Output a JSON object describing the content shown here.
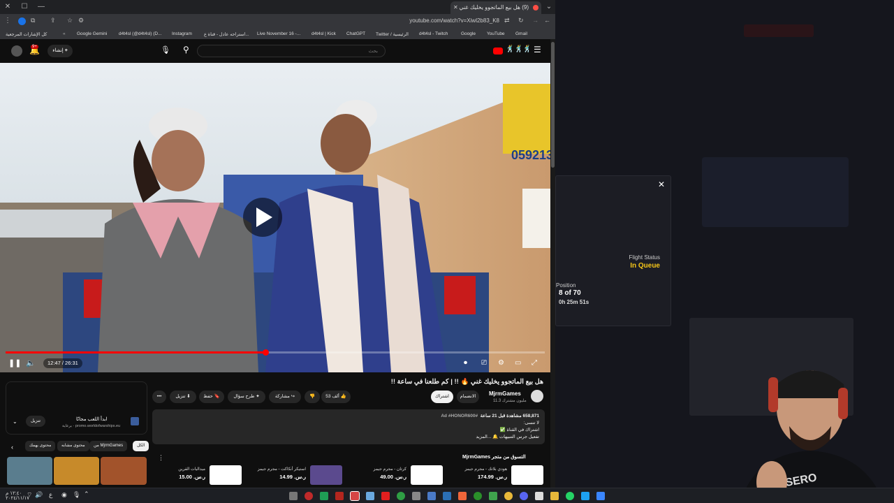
{
  "browser": {
    "tab_title": "(9) هل بيع الماتجوو يخليك غني",
    "url": "youtube.com/watch?v=Xiwl2b83_K8",
    "bookmarks": [
      "كل الإشارات المرجعية",
      "Google Gemini",
      "d4t4sl (@d4t4sl) (D...",
      "Instagram",
      "استراحه عادل - قناة ع...",
      "Live November 16 -...",
      "d4t4sl | Kick",
      "ChatGPT",
      "Twitter / الرئيسية",
      "d4t4sl - Twitch",
      "Google",
      "YouTube",
      "Gmail"
    ]
  },
  "yt_header": {
    "create_label": "إنشاء",
    "notification_count": "9+",
    "search_placeholder": "بحث"
  },
  "player": {
    "time": "12:47 / 26:31",
    "progress": 0.482,
    "billboard_number": "059213"
  },
  "video_info": {
    "title": "هل بيع الماتجوو يخليك غني 🔥 !! | كم طلعنا في ساعة !!",
    "channel_name": "MjrmGames",
    "subscribers": "11.3 مليون مشترك",
    "join_label": "الانضمام",
    "subscribe_label": "اشتراك",
    "like_count": "53 ألف",
    "share_label": "مشاركة",
    "ask_label": "طرح سؤال",
    "save_label": "حفظ",
    "download_label": "تنزيل"
  },
  "description": {
    "stats": "658,871 مشاهدة قبل 21 ساعة",
    "hashtags": "#Ad #HONOR600",
    "lines": [
      "لا تنسى:",
      "اشتراك في القناة ✅",
      "تفعيل جرس التنبيهات 🔔 ...المزيد"
    ]
  },
  "side_panel": {
    "ad_text": "ابدأ اللعب مجانًا",
    "ad_sponsor": "برعاية · promo.worldofwarships.eu",
    "ad_button": "تنزيل",
    "chips": [
      "الكل",
      "من MjrmGames",
      "محتوى مشابه",
      "محتوى يهمك"
    ]
  },
  "store": {
    "heading": "التسوق من متجر MjrmGames",
    "products": [
      {
        "name": "هودي بلاتك - مجرم جيمز",
        "price": "ر.س. 174.99"
      },
      {
        "name": "كرتان - مجرم جيمز",
        "price": "ر.س. 49.00"
      },
      {
        "name": "استيكر أنكاكت - مجرم جيمز",
        "price": "ر.س. 14.99"
      },
      {
        "name": "ميداليات القرين",
        "price": "ر.س. 15.00"
      }
    ]
  },
  "flight_widget": {
    "status_label": "Flight Status",
    "status_value": "In Queue",
    "position_label": "Position",
    "position_value": "8 of 70",
    "eta": "0h 25m 51s"
  },
  "taskbar": {
    "clock_time": "١٢:٤٠ م",
    "clock_date": "٢٠٢٤/١١/١٧",
    "lang": "ع"
  },
  "colors": {
    "accent_red": "#ff0000",
    "queue_yellow": "#f5c518",
    "yt_bg": "#0f0f0f"
  }
}
